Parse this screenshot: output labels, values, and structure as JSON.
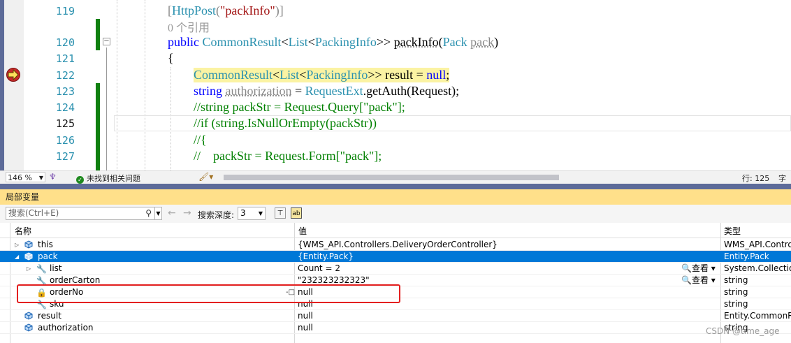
{
  "editor": {
    "lines": [
      {
        "num": "119",
        "text": "[HttpPost(\"packInfo\")]"
      },
      {
        "num": "",
        "text": "0 个引用"
      },
      {
        "num": "120",
        "text": "public CommonResult<List<PackingInfo>> packInfo(Pack pack)"
      },
      {
        "num": "121",
        "text": "{"
      },
      {
        "num": "122",
        "text": "CommonResult<List<PackingInfo>> result = null;"
      },
      {
        "num": "123",
        "text": "string authorization = RequestExt.getAuth(Request);"
      },
      {
        "num": "124",
        "text": "//string packStr = Request.Query[\"pack\"];"
      },
      {
        "num": "125",
        "text": "//if (string.IsNullOrEmpty(packStr))"
      },
      {
        "num": "126",
        "text": "//{"
      },
      {
        "num": "127",
        "text": "//    packStr = Request.Form[\"pack\"];"
      }
    ],
    "current_line": "125",
    "breakpoint_line": "122"
  },
  "status": {
    "zoom": "146 %",
    "issues": "未找到相关问题",
    "row": "行: 125",
    "char": "字符"
  },
  "locals": {
    "title": "局部变量",
    "search_placeholder": "搜索(Ctrl+E)",
    "depth_label": "搜索深度:",
    "depth_value": "3",
    "headers": {
      "name": "名称",
      "value": "值",
      "type": "类型"
    },
    "rows": [
      {
        "name": "this",
        "value": "{WMS_API.Controllers.DeliveryOrderController}",
        "type": "WMS_API.Controll",
        "view": ""
      },
      {
        "name": "pack",
        "value": "{Entity.Pack}",
        "type": "Entity.Pack",
        "view": ""
      },
      {
        "name": "list",
        "value": "Count = 2",
        "type": "System.Collection",
        "view": "查看"
      },
      {
        "name": "orderCarton",
        "value": "\"232323232323\"",
        "type": "string",
        "view": "查看"
      },
      {
        "name": "orderNo",
        "value": "null",
        "type": "string",
        "view": ""
      },
      {
        "name": "sku",
        "value": "null",
        "type": "string",
        "view": ""
      },
      {
        "name": "result",
        "value": "null",
        "type": "Entity.CommonRe",
        "view": ""
      },
      {
        "name": "authorization",
        "value": "null",
        "type": "string",
        "view": ""
      }
    ]
  },
  "watermark": "CSDN @time_age"
}
